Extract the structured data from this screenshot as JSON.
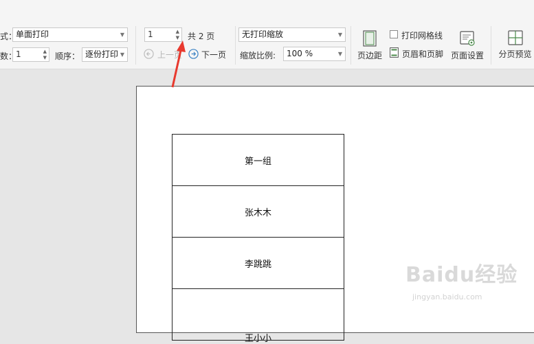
{
  "toolbar": {
    "mode_label_partial": "式：",
    "mode_value": "单面打印",
    "copies_label_partial": "数：",
    "copies_value": "1",
    "order_label": "顺序：",
    "order_value": "逐份打印",
    "page_input_value": "1",
    "total_pages": "共 2 页",
    "prev_page_label": "上一页",
    "next_page_label": "下一页",
    "scaling_mode_value": "无打印缩放",
    "scale_label": "缩放比例:",
    "scale_value": "100 %",
    "margins_label": "页边距",
    "print_grid_label": "打印网格线",
    "header_footer_label": "页眉和页脚",
    "page_setup_label": "页面设置",
    "page_break_preview_label": "分页预览"
  },
  "document": {
    "rows": [
      "第一组",
      "张木木",
      "李跳跳",
      "王小小"
    ]
  },
  "watermark": {
    "main": "Baidu经验",
    "sub": "jingyan.baidu.com"
  },
  "colors": {
    "annotation_arrow": "#e8392e",
    "nav_circle": "#3b82c4"
  }
}
